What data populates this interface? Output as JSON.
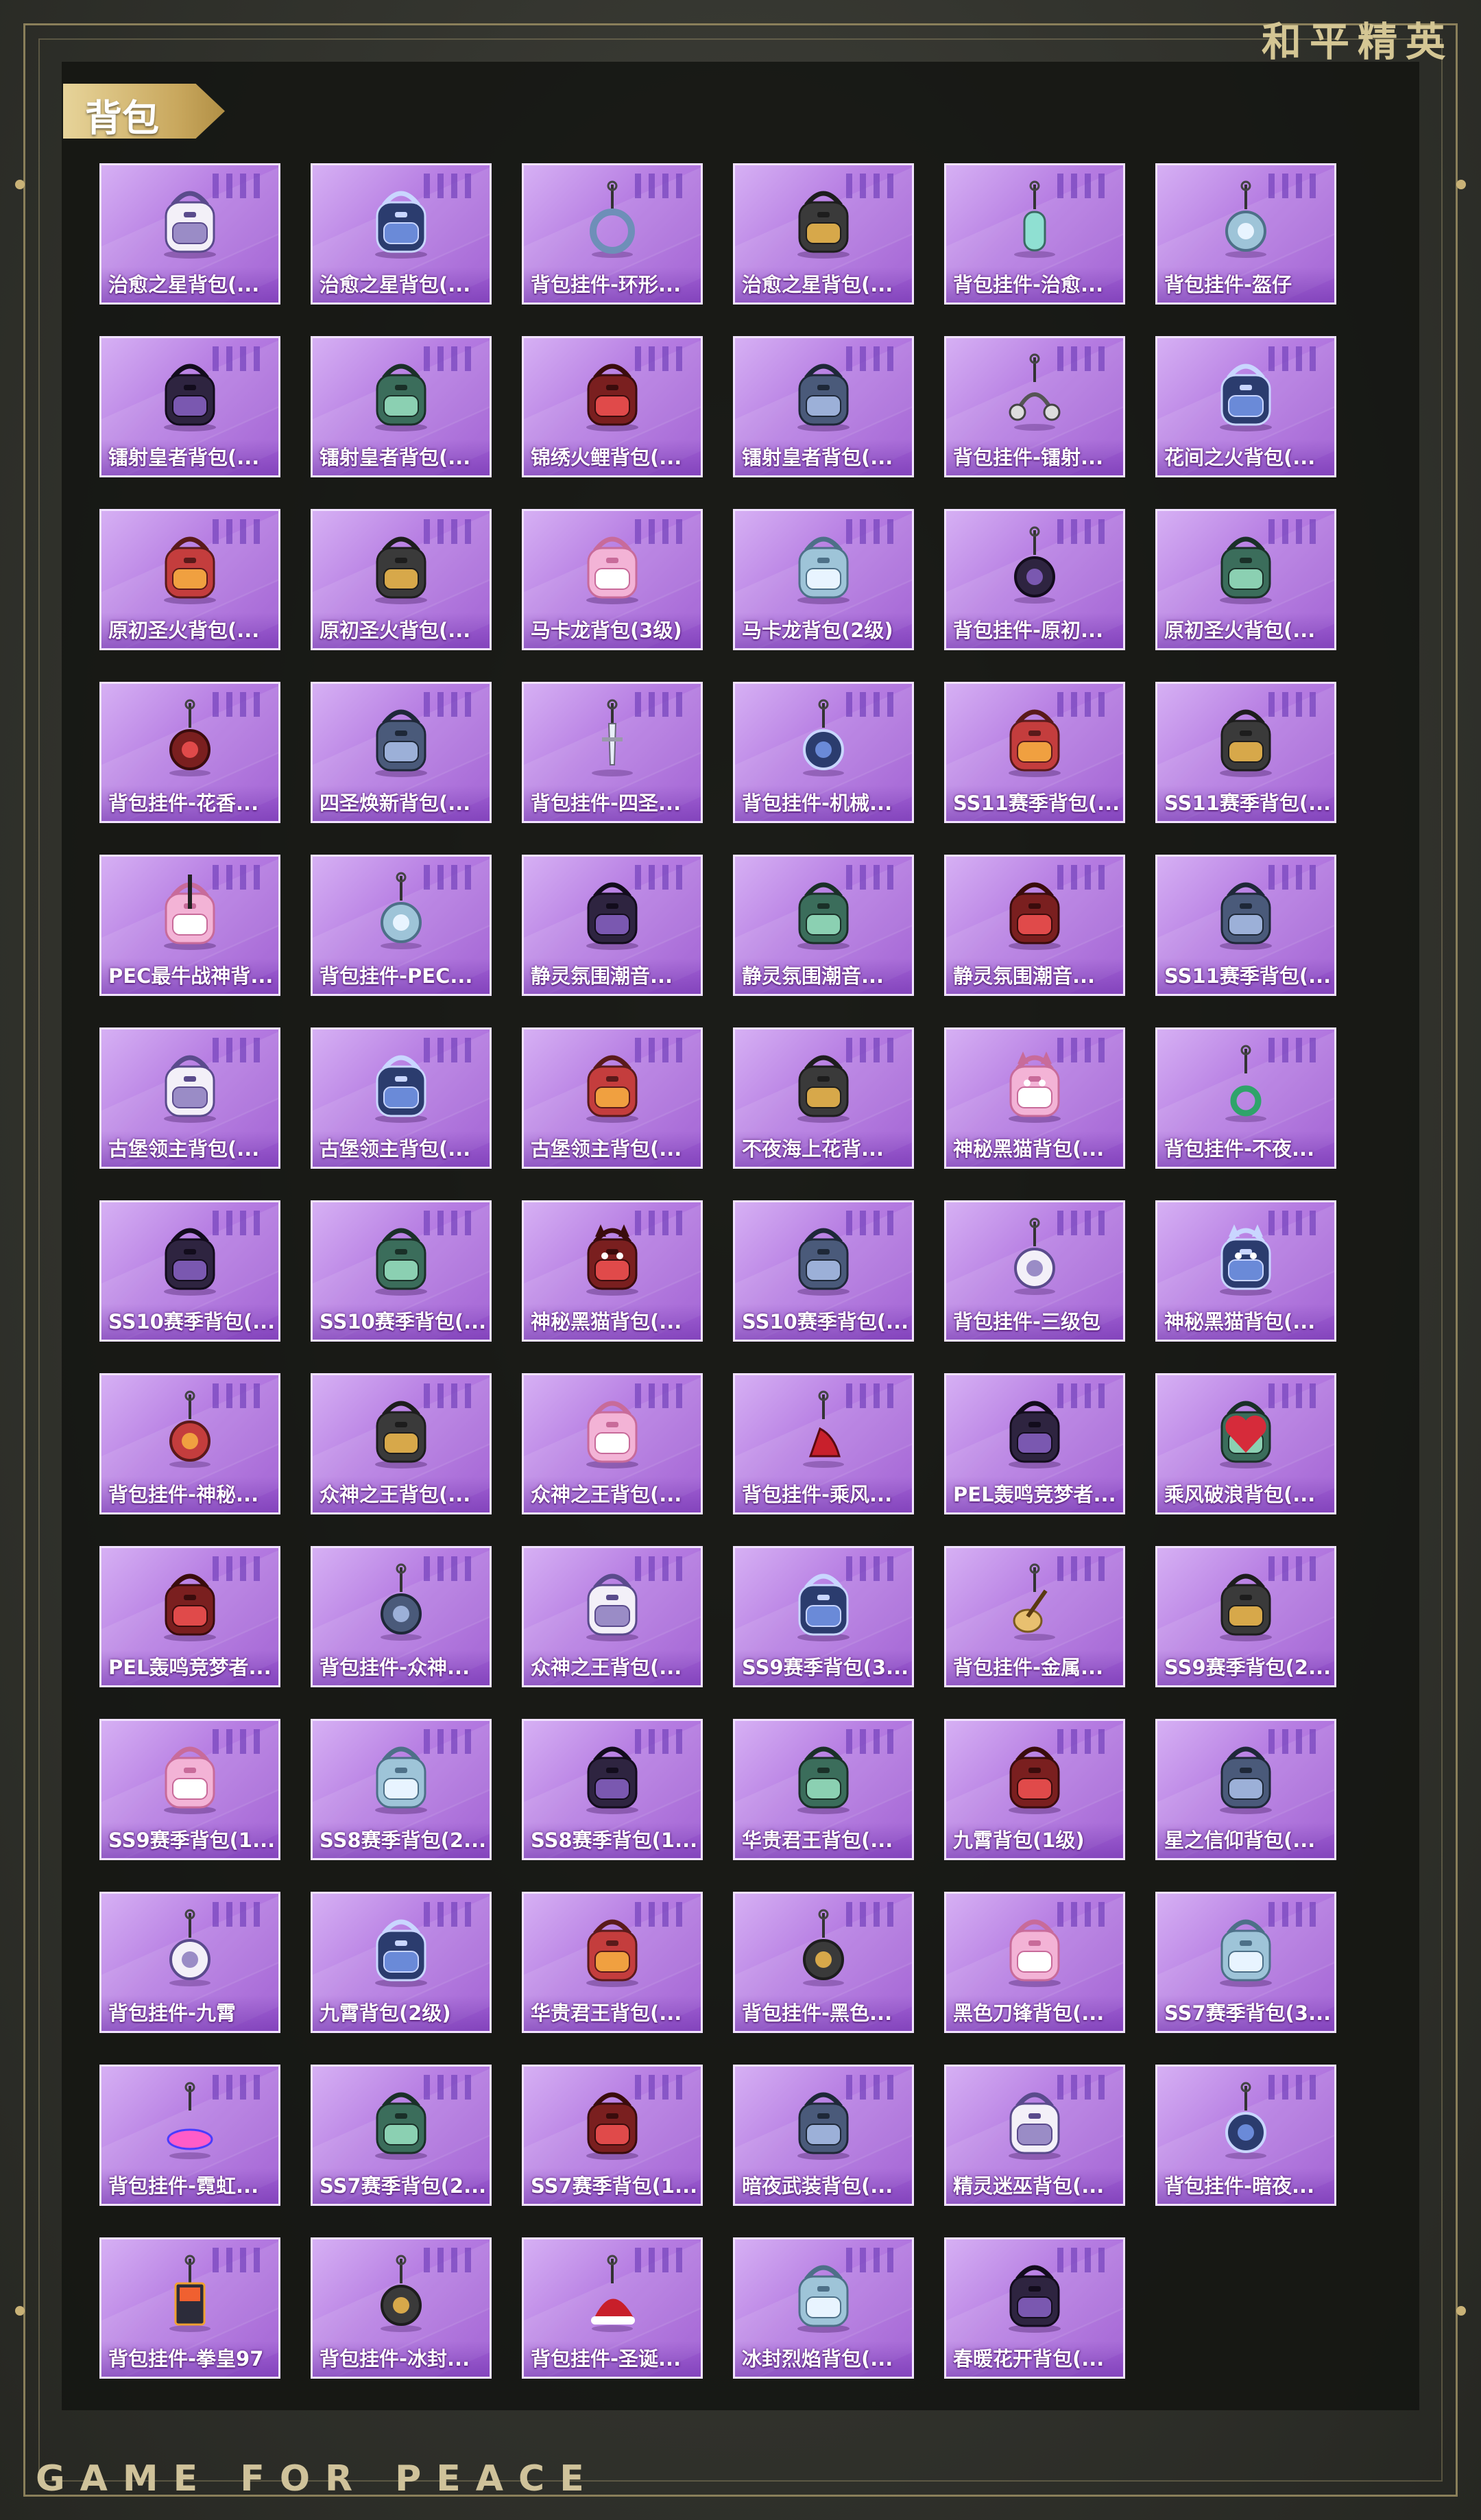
{
  "brand": "和平精英",
  "footer_brand": "GAME FOR PEACE",
  "section": {
    "title": "背包"
  },
  "items": [
    {
      "label": "治愈之星背包(...",
      "icon": "backpack-icon"
    },
    {
      "label": "治愈之星背包(...",
      "icon": "backpack-icon"
    },
    {
      "label": "背包挂件-环形...",
      "icon": "ring-pendant-icon"
    },
    {
      "label": "治愈之星背包(...",
      "icon": "backpack-icon"
    },
    {
      "label": "背包挂件-治愈...",
      "icon": "capsule-pendant-icon"
    },
    {
      "label": "背包挂件-盔仔",
      "icon": "character-pendant-icon"
    },
    {
      "label": "镭射皇者背包(...",
      "icon": "backpack-icon"
    },
    {
      "label": "镭射皇者背包(...",
      "icon": "backpack-icon"
    },
    {
      "label": "锦绣火鲤背包(...",
      "icon": "backpack-icon"
    },
    {
      "label": "镭射皇者背包(...",
      "icon": "backpack-icon"
    },
    {
      "label": "背包挂件-镭射...",
      "icon": "headphones-pendant-icon"
    },
    {
      "label": "花间之火背包(...",
      "icon": "backpack-icon"
    },
    {
      "label": "原初圣火背包(...",
      "icon": "backpack-icon"
    },
    {
      "label": "原初圣火背包(...",
      "icon": "backpack-icon"
    },
    {
      "label": "马卡龙背包(3级)",
      "icon": "backpack-icon"
    },
    {
      "label": "马卡龙背包(2级)",
      "icon": "backpack-icon"
    },
    {
      "label": "背包挂件-原初...",
      "icon": "emblem-pendant-icon"
    },
    {
      "label": "原初圣火背包(...",
      "icon": "backpack-icon"
    },
    {
      "label": "背包挂件-花香...",
      "icon": "charm-pendant-icon"
    },
    {
      "label": "四圣焕新背包(...",
      "icon": "backpack-icon"
    },
    {
      "label": "背包挂件-四圣...",
      "icon": "sword-pendant-icon"
    },
    {
      "label": "背包挂件-机械...",
      "icon": "mask-pendant-icon"
    },
    {
      "label": "SS11赛季背包(...",
      "icon": "backpack-icon"
    },
    {
      "label": "SS11赛季背包(...",
      "icon": "backpack-icon"
    },
    {
      "label": "PEC最牛战神背...",
      "icon": "guitar-backpack-icon"
    },
    {
      "label": "背包挂件-PEC...",
      "icon": "character-pendant-icon"
    },
    {
      "label": "静灵氛围潮音...",
      "icon": "backpack-icon"
    },
    {
      "label": "静灵氛围潮音...",
      "icon": "backpack-icon"
    },
    {
      "label": "静灵氛围潮音...",
      "icon": "backpack-icon"
    },
    {
      "label": "SS11赛季背包(...",
      "icon": "backpack-icon"
    },
    {
      "label": "古堡领主背包(...",
      "icon": "backpack-icon"
    },
    {
      "label": "古堡领主背包(...",
      "icon": "backpack-icon"
    },
    {
      "label": "古堡领主背包(...",
      "icon": "backpack-icon"
    },
    {
      "label": "不夜海上花背...",
      "icon": "backpack-icon"
    },
    {
      "label": "神秘黑猫背包(...",
      "icon": "cat-backpack-icon"
    },
    {
      "label": "背包挂件-不夜...",
      "icon": "jade-pendant-icon"
    },
    {
      "label": "SS10赛季背包(...",
      "icon": "backpack-icon"
    },
    {
      "label": "SS10赛季背包(...",
      "icon": "backpack-icon"
    },
    {
      "label": "神秘黑猫背包(...",
      "icon": "cat-backpack-icon"
    },
    {
      "label": "SS10赛季背包(...",
      "icon": "backpack-icon"
    },
    {
      "label": "背包挂件-三级包",
      "icon": "mini-backpack-pendant-icon"
    },
    {
      "label": "神秘黑猫背包(...",
      "icon": "cat-backpack-icon"
    },
    {
      "label": "背包挂件-神秘...",
      "icon": "cat-pendant-icon"
    },
    {
      "label": "众神之王背包(...",
      "icon": "backpack-icon"
    },
    {
      "label": "众神之王背包(...",
      "icon": "backpack-icon"
    },
    {
      "label": "背包挂件-乘风...",
      "icon": "heel-pendant-icon"
    },
    {
      "label": "PEL轰鸣竞梦者...",
      "icon": "backpack-icon"
    },
    {
      "label": "乘风破浪背包(...",
      "icon": "heart-backpack-icon"
    },
    {
      "label": "PEL轰鸣竞梦者...",
      "icon": "backpack-icon"
    },
    {
      "label": "背包挂件-众神...",
      "icon": "helmet-pendant-icon"
    },
    {
      "label": "众神之王背包(...",
      "icon": "backpack-icon"
    },
    {
      "label": "SS9赛季背包(3...",
      "icon": "backpack-icon"
    },
    {
      "label": "背包挂件-金属...",
      "icon": "guitar-pendant-icon"
    },
    {
      "label": "SS9赛季背包(2...",
      "icon": "backpack-icon"
    },
    {
      "label": "SS9赛季背包(1...",
      "icon": "backpack-icon"
    },
    {
      "label": "SS8赛季背包(2...",
      "icon": "backpack-icon"
    },
    {
      "label": "SS8赛季背包(1...",
      "icon": "backpack-icon"
    },
    {
      "label": "华贵君王背包(...",
      "icon": "backpack-icon"
    },
    {
      "label": "九霄背包(1级)",
      "icon": "backpack-icon"
    },
    {
      "label": "星之信仰背包(...",
      "icon": "backpack-icon"
    },
    {
      "label": "背包挂件-九霄",
      "icon": "key-pendant-icon"
    },
    {
      "label": "九霄背包(2级)",
      "icon": "backpack-icon"
    },
    {
      "label": "华贵君王背包(...",
      "icon": "backpack-icon"
    },
    {
      "label": "背包挂件-黑色...",
      "icon": "badge-pendant-icon"
    },
    {
      "label": "黑色刀锋背包(...",
      "icon": "backpack-icon"
    },
    {
      "label": "SS7赛季背包(3...",
      "icon": "backpack-icon"
    },
    {
      "label": "背包挂件-霓虹...",
      "icon": "neon-pendant-icon"
    },
    {
      "label": "SS7赛季背包(2...",
      "icon": "backpack-icon"
    },
    {
      "label": "SS7赛季背包(1...",
      "icon": "backpack-icon"
    },
    {
      "label": "暗夜武装背包(...",
      "icon": "backpack-icon"
    },
    {
      "label": "精灵迷巫背包(...",
      "icon": "backpack-icon"
    },
    {
      "label": "背包挂件-暗夜...",
      "icon": "gem-pendant-icon"
    },
    {
      "label": "背包挂件-拳皇97",
      "icon": "arcade-pendant-icon"
    },
    {
      "label": "背包挂件-冰封...",
      "icon": "lantern-pendant-icon"
    },
    {
      "label": "背包挂件-圣诞...",
      "icon": "santa-hat-pendant-icon"
    },
    {
      "label": "冰封烈焰背包(...",
      "icon": "backpack-icon"
    },
    {
      "label": "春暖花开背包(...",
      "icon": "backpack-icon"
    }
  ]
}
